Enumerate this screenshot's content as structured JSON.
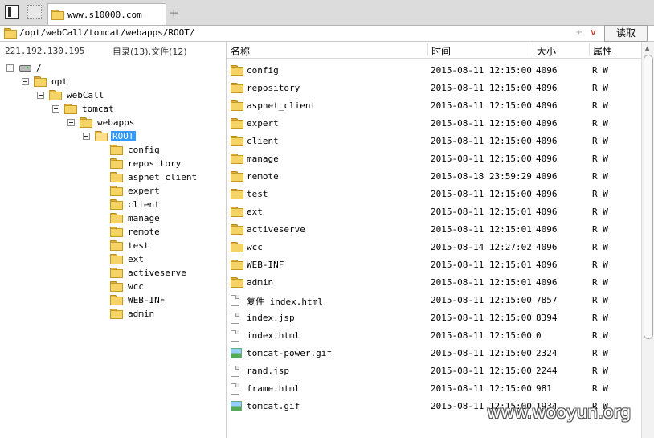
{
  "tab": {
    "title": "www.s10000.com",
    "add": "+"
  },
  "address": {
    "path": "/opt/webCall/tomcat/webapps/ROOT/",
    "updown": "±",
    "chevron": "∨",
    "read_label": "读取"
  },
  "left": {
    "ip": "221.192.130.195",
    "counts": "目录(13),文件(12)"
  },
  "tree": [
    {
      "label": "/",
      "icon": "drive-icon",
      "toggle": true
    },
    {
      "label": "opt",
      "icon": "folder-icon",
      "toggle": true
    },
    {
      "label": "webCall",
      "icon": "folder-icon",
      "toggle": true
    },
    {
      "label": "tomcat",
      "icon": "folder-icon",
      "toggle": true
    },
    {
      "label": "webapps",
      "icon": "folder-icon",
      "toggle": true
    },
    {
      "label": "ROOT",
      "icon": "folder-open-icon",
      "toggle": true,
      "selected": true
    },
    {
      "label": "config",
      "icon": "folder-icon"
    },
    {
      "label": "repository",
      "icon": "folder-icon"
    },
    {
      "label": "aspnet_client",
      "icon": "folder-icon"
    },
    {
      "label": "expert",
      "icon": "folder-icon"
    },
    {
      "label": "client",
      "icon": "folder-icon"
    },
    {
      "label": "manage",
      "icon": "folder-icon"
    },
    {
      "label": "remote",
      "icon": "folder-icon"
    },
    {
      "label": "test",
      "icon": "folder-icon"
    },
    {
      "label": "ext",
      "icon": "folder-icon"
    },
    {
      "label": "activeserve",
      "icon": "folder-icon"
    },
    {
      "label": "wcc",
      "icon": "folder-icon"
    },
    {
      "label": "WEB-INF",
      "icon": "folder-icon"
    },
    {
      "label": "admin",
      "icon": "folder-icon"
    }
  ],
  "columns": {
    "name": "名称",
    "time": "时间",
    "size": "大小",
    "attr": "属性"
  },
  "files": [
    {
      "name": "config",
      "icon": "folder-icon",
      "time": "2015-08-11 12:15:00",
      "size": "4096",
      "attr": "R W"
    },
    {
      "name": "repository",
      "icon": "folder-icon",
      "time": "2015-08-11 12:15:00",
      "size": "4096",
      "attr": "R W"
    },
    {
      "name": "aspnet_client",
      "icon": "folder-icon",
      "time": "2015-08-11 12:15:00",
      "size": "4096",
      "attr": "R W"
    },
    {
      "name": "expert",
      "icon": "folder-icon",
      "time": "2015-08-11 12:15:00",
      "size": "4096",
      "attr": "R W"
    },
    {
      "name": "client",
      "icon": "folder-icon",
      "time": "2015-08-11 12:15:00",
      "size": "4096",
      "attr": "R W"
    },
    {
      "name": "manage",
      "icon": "folder-icon",
      "time": "2015-08-11 12:15:00",
      "size": "4096",
      "attr": "R W"
    },
    {
      "name": "remote",
      "icon": "folder-icon",
      "time": "2015-08-18 23:59:29",
      "size": "4096",
      "attr": "R W"
    },
    {
      "name": "test",
      "icon": "folder-icon",
      "time": "2015-08-11 12:15:00",
      "size": "4096",
      "attr": "R W"
    },
    {
      "name": "ext",
      "icon": "folder-icon",
      "time": "2015-08-11 12:15:01",
      "size": "4096",
      "attr": "R W"
    },
    {
      "name": "activeserve",
      "icon": "folder-icon",
      "time": "2015-08-11 12:15:01",
      "size": "4096",
      "attr": "R W"
    },
    {
      "name": "wcc",
      "icon": "folder-icon",
      "time": "2015-08-14 12:27:02",
      "size": "4096",
      "attr": "R W"
    },
    {
      "name": "WEB-INF",
      "icon": "folder-icon",
      "time": "2015-08-11 12:15:01",
      "size": "4096",
      "attr": "R W"
    },
    {
      "name": "admin",
      "icon": "folder-icon",
      "time": "2015-08-11 12:15:01",
      "size": "4096",
      "attr": "R W"
    },
    {
      "name": "复件 index.html",
      "icon": "file-icon",
      "time": "2015-08-11 12:15:00",
      "size": "7857",
      "attr": "R W"
    },
    {
      "name": "index.jsp",
      "icon": "file-icon",
      "time": "2015-08-11 12:15:00",
      "size": "8394",
      "attr": "R W"
    },
    {
      "name": "index.html",
      "icon": "file-icon",
      "time": "2015-08-11 12:15:00",
      "size": "0",
      "attr": "R W"
    },
    {
      "name": "tomcat-power.gif",
      "icon": "image-file-icon",
      "time": "2015-08-11 12:15:00",
      "size": "2324",
      "attr": "R W"
    },
    {
      "name": "rand.jsp",
      "icon": "file-icon",
      "time": "2015-08-11 12:15:00",
      "size": "2244",
      "attr": "R W"
    },
    {
      "name": "frame.html",
      "icon": "file-icon",
      "time": "2015-08-11 12:15:00",
      "size": "981",
      "attr": "R W"
    },
    {
      "name": "tomcat.gif",
      "icon": "image-file-icon",
      "time": "2015-08-11 12:15:00",
      "size": "1934",
      "attr": "R W"
    }
  ],
  "watermark": "www.wooyun.org"
}
